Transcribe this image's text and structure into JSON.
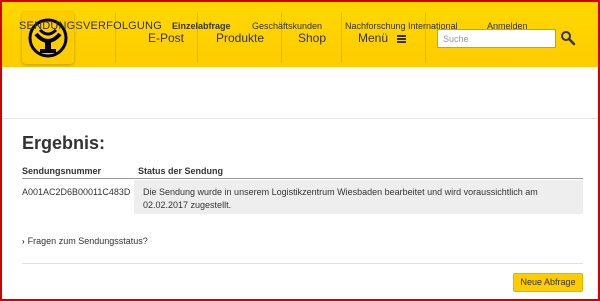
{
  "header": {
    "logo_icon": "posthorn-icon",
    "nav": {
      "epost": "E-Post",
      "produkte": "Produkte",
      "shop": "Shop",
      "menu": "Menü"
    },
    "search": {
      "placeholder": "Suche",
      "value": ""
    },
    "search_icon": "magnifier-icon",
    "colors": {
      "brand_yellow": "#ffcc00",
      "text": "#333333"
    }
  },
  "subnav": {
    "title": "SENDUNGSVERFOLGUNG",
    "links": [
      {
        "label": "Einzelabfrage",
        "active": true
      },
      {
        "label": "Geschäftskunden",
        "active": false
      },
      {
        "label": "Nachforschung International",
        "active": false
      },
      {
        "label": "Anmelden",
        "active": false
      }
    ]
  },
  "main": {
    "heading": "Ergebnis:",
    "table": {
      "columns": [
        "Sendungsnummer",
        "Status der Sendung"
      ],
      "rows": [
        {
          "id": "A001AC2D6B00011C483D",
          "status": "Die Sendung wurde in unserem Logistikzentrum Wiesbaden bearbeitet und wird voraussichtlich am 02.02.2017 zugestellt."
        }
      ]
    },
    "faq_link": "Fragen zum Sendungsstatus?",
    "new_query_button": "Neue Abfrage"
  }
}
